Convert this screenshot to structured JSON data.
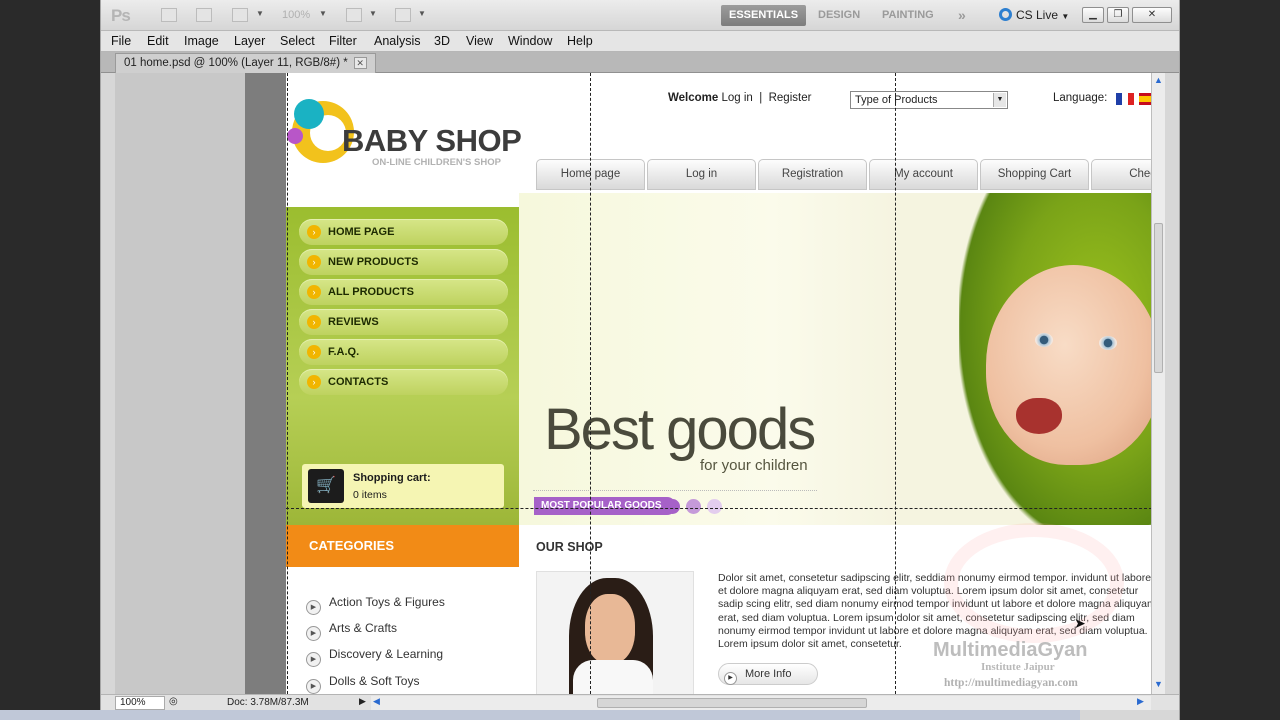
{
  "app": {
    "logo": "Ps",
    "zoom_field": "100%",
    "workspaces": [
      "ESSENTIALS",
      "DESIGN",
      "PAINTING"
    ],
    "more_workspaces": "»",
    "cs_live": "CS Live"
  },
  "menu": [
    "File",
    "Edit",
    "Image",
    "Layer",
    "Select",
    "Filter",
    "Analysis",
    "3D",
    "View",
    "Window",
    "Help"
  ],
  "document_tab": "01 home.psd @ 100% (Layer 11, RGB/8#) *",
  "status": {
    "zoom": "100%",
    "doc": "Doc: 3.78M/87.3M"
  },
  "site": {
    "logo": {
      "title": "BABY SHOP",
      "subtitle": "ON-LINE CHILDREN'S SHOP"
    },
    "header": {
      "welcome": "Welcome",
      "login": "Log in",
      "separator": "|",
      "register": "Register",
      "type_select": "Type of Products",
      "language_label": "Language:"
    },
    "nav_tabs": [
      "Home page",
      "Log in",
      "Registration",
      "My account",
      "Shopping Cart",
      "Check"
    ],
    "side_nav": [
      "HOME PAGE",
      "NEW PRODUCTS",
      "ALL PRODUCTS",
      "REVIEWS",
      "F.A.Q.",
      "CONTACTS"
    ],
    "cart": {
      "title": "Shopping cart:",
      "items": "0 items"
    },
    "hero": {
      "headline": "Best goods",
      "subline": "for your children",
      "badge": "MOST POPULAR GOODS"
    },
    "categories": {
      "title": "CATEGORIES",
      "items": [
        "Action Toys & Figures",
        "Arts & Crafts",
        "Discovery & Learning",
        "Dolls & Soft Toys"
      ]
    },
    "our_shop": {
      "title": "OUR SHOP",
      "text": "Dolor sit amet, consetetur sadipscing elitr, seddiam nonumy eirmod tempor. invidunt ut labore et dolore magna aliquyam erat, sed diam voluptua. Lorem ipsum dolor sit amet, consetetur sadip scing elitr, sed diam nonumy eirmod tempor invidunt ut labore et dolore magna aliquyam erat, sed diam voluptua. Lorem ipsum dolor sit amet, consetetur sadipscing elitr, sed diam nonumy eirmod tempor invidunt ut labore et dolore magna aliquyam erat, sed diam voluptua. Lorem ipsum dolor sit amet, consetetur.",
      "more": "More Info"
    },
    "watermark": {
      "name": "MultimediaGyan",
      "sub": "Institute Jaipur",
      "url": "http://multimediagyan.com"
    }
  },
  "colors": {
    "green": "#9bbd2f",
    "orange": "#f28b16",
    "purple": "#a661c8",
    "yellow": "#f1b500"
  }
}
